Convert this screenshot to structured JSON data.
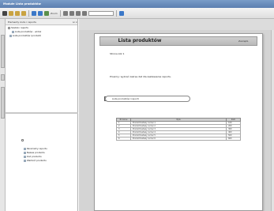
{
  "window": {
    "title": "Modułe  Lista produktów"
  },
  "toolbar": {
    "zoom": "Zoom",
    "buttons": [
      {
        "icon": "select-arrow-icon",
        "color": "#444444"
      },
      {
        "icon": "report-icon",
        "color": "#c9a341"
      },
      {
        "icon": "page-icon",
        "color": "#c9a341"
      },
      {
        "icon": "table-icon",
        "color": "#c9a341"
      },
      {
        "icon": "play-icon",
        "color": "#3b78c8"
      },
      {
        "icon": "run-icon",
        "color": "#3b78c8"
      },
      {
        "icon": "filter-icon",
        "color": "#5a8f4a"
      },
      {
        "icon": "link-icon",
        "color": "#7a7a7a"
      },
      {
        "icon": "zoom-icon",
        "color": "#7a7a7a"
      },
      {
        "icon": "print-icon",
        "color": "#7a7a7a"
      },
      {
        "icon": "pen-icon",
        "color": "#7a7a7a"
      },
      {
        "icon": "layout-icon",
        "color": "#3b78c8"
      }
    ]
  },
  "left_panel": {
    "header": "Elementy kodu i raportu",
    "tree": [
      {
        "label": "Szablon raportu"
      },
      {
        "label": "Lista produktów - widok"
      },
      {
        "label": "Lista produktów (produkt)"
      }
    ],
    "bottom_tree": [
      {
        "label": "Parametry raportu"
      },
      {
        "label": "Nazwa produktu"
      },
      {
        "label": "Kod produktu"
      },
      {
        "label": "Wartość produktu"
      }
    ]
  },
  "report": {
    "title": "Lista produktów",
    "header_right": "Zarządz.",
    "page_label": "Strona zzz 1",
    "info_line": "Prosimy: wybrać zakres dat dla zestawienia raportu.",
    "param_label": "Lista produktów (raport)",
    "table": {
      "headers": [
        "Nr kursu",
        "Opis",
        "Zam"
      ],
      "rows": [
        [
          "1",
          "Produkt testowy numer 1",
          "100"
        ],
        [
          "2",
          "Produkt testowy numer 2",
          "200"
        ],
        [
          "3",
          "Produkt testowy numer 3",
          "300"
        ],
        [
          "4",
          "Produkt testowy numer 4",
          "400"
        ],
        [
          "5",
          "Produkt testowy numer 5",
          "500"
        ],
        [
          "6",
          "Produkt testowy numer 6",
          "600"
        ]
      ]
    }
  }
}
